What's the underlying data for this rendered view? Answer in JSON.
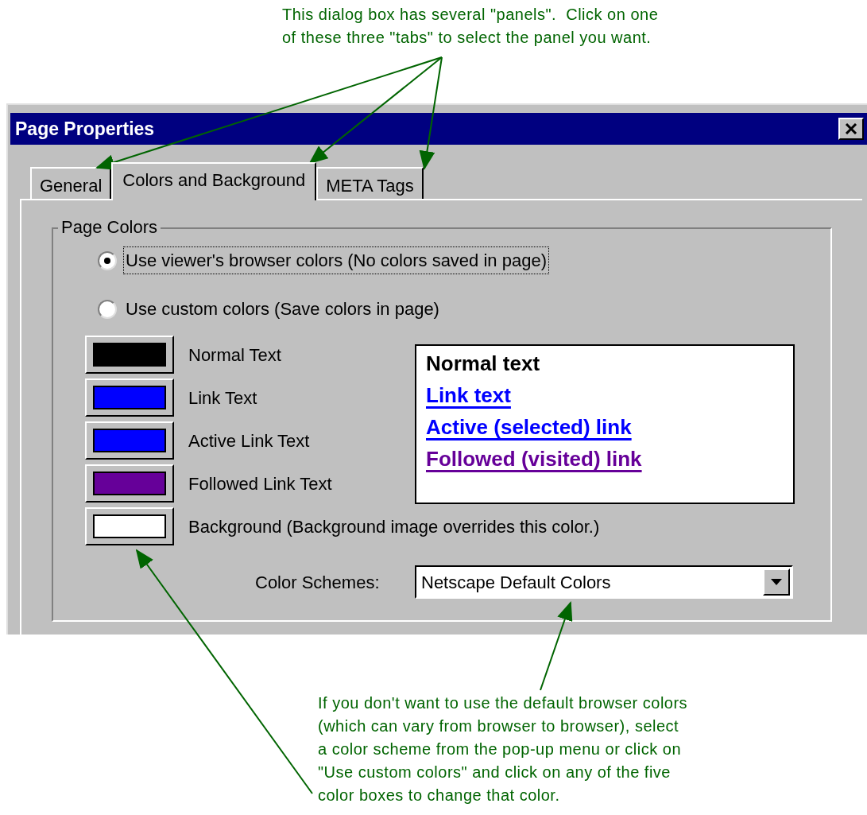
{
  "annotations": [
    {
      "kind": "top",
      "lines": [
        "This dialog box has several \"panels\".  Click on one",
        "of these three \"tabs\" to select the panel you want."
      ]
    },
    {
      "kind": "bottom",
      "lines": [
        "If you don't want to use the default browser colors",
        "(which can vary from browser to browser), select",
        "a color scheme from the pop-up menu or click on",
        "\"Use custom colors\" and click on any of the five",
        "color boxes to change that color."
      ]
    }
  ],
  "window": {
    "title": "Page Properties"
  },
  "tabs": [
    {
      "label": "General",
      "selected": false
    },
    {
      "label": "Colors and Background",
      "selected": true
    },
    {
      "label": "META Tags",
      "selected": false
    }
  ],
  "page_colors": {
    "title": "Page Colors",
    "radios": [
      {
        "label": "Use viewer's browser colors (No colors saved in page)",
        "selected": true
      },
      {
        "label": "Use custom colors (Save colors in page)",
        "selected": false
      }
    ],
    "color_buttons": [
      {
        "label": "Normal Text",
        "color": "#000000"
      },
      {
        "label": "Link Text",
        "color": "#0000ff"
      },
      {
        "label": "Active Link Text",
        "color": "#0000ff"
      },
      {
        "label": "Followed Link Text",
        "color": "#660099"
      },
      {
        "label": "Background (Background image overrides this color.)",
        "color": "#ffffff"
      }
    ],
    "preview": [
      {
        "text": "Normal text",
        "kind": "normal",
        "color": "#000000"
      },
      {
        "text": "Link text",
        "kind": "link",
        "color": "#0000ff"
      },
      {
        "text": "Active (selected) link",
        "kind": "link",
        "color": "#0000ff"
      },
      {
        "text": "Followed (visited) link",
        "kind": "link",
        "color": "#660099"
      }
    ],
    "scheme": {
      "label": "Color Schemes:",
      "value": "Netscape Default Colors"
    }
  }
}
